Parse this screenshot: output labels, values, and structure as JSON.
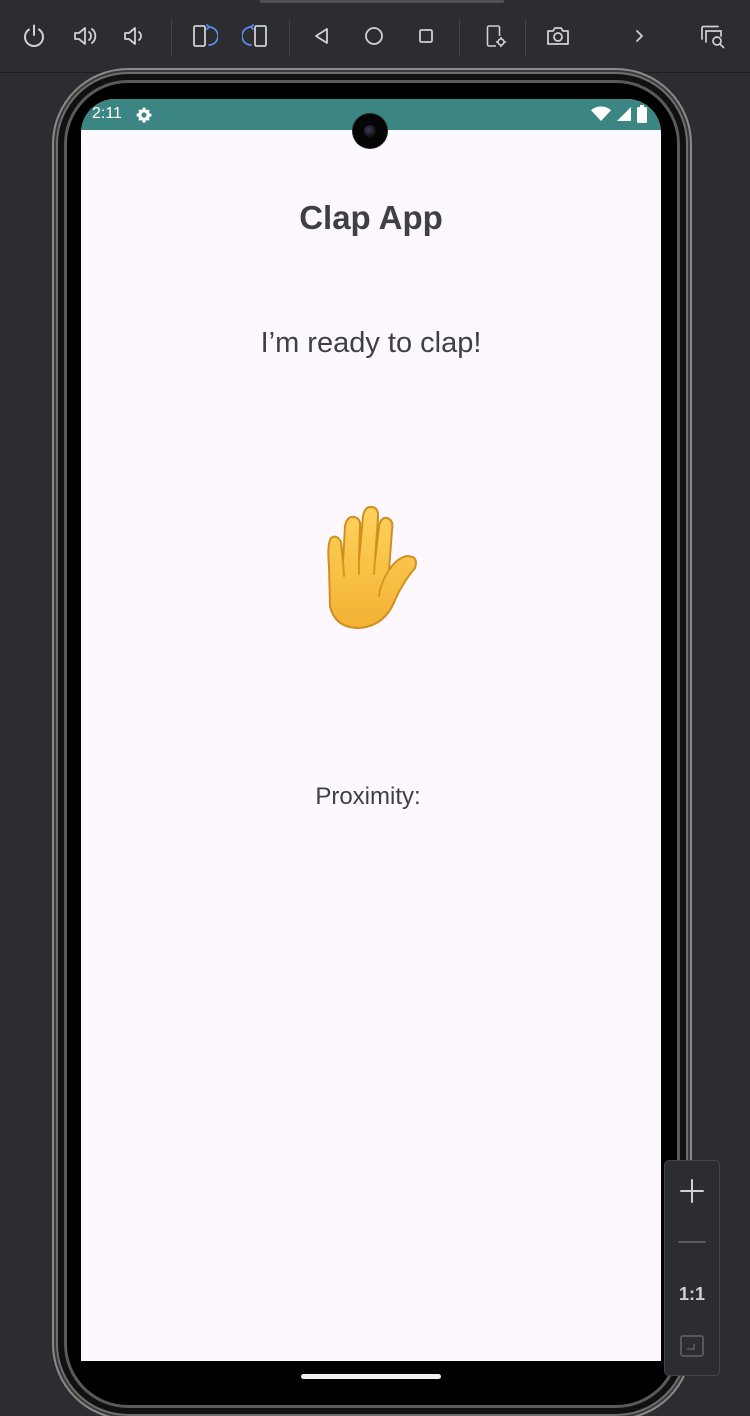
{
  "emulator_toolbar": {
    "buttons": [
      {
        "icon": "power-icon"
      },
      {
        "icon": "volume-up-icon"
      },
      {
        "icon": "volume-down-icon"
      },
      {
        "icon": "rotate-left-icon"
      },
      {
        "icon": "rotate-right-icon"
      },
      {
        "icon": "back-icon"
      },
      {
        "icon": "home-icon"
      },
      {
        "icon": "overview-icon"
      },
      {
        "icon": "device-settings-icon"
      },
      {
        "icon": "camera-icon"
      },
      {
        "icon": "chevron-right-icon"
      },
      {
        "icon": "zoom-window-icon"
      }
    ]
  },
  "statusbar": {
    "time": "2:11",
    "color": "#3b8683"
  },
  "app": {
    "title": "Clap App",
    "message": "I’m ready to clap!",
    "hand_emoji": "raised-hand",
    "proximity_label": "Proximity:"
  },
  "zoom_controls": {
    "one_to_one": "1:1"
  },
  "colors": {
    "screen_bg": "#fdf7fe",
    "text": "#3f3f46",
    "accent_blue": "#5b8def"
  }
}
